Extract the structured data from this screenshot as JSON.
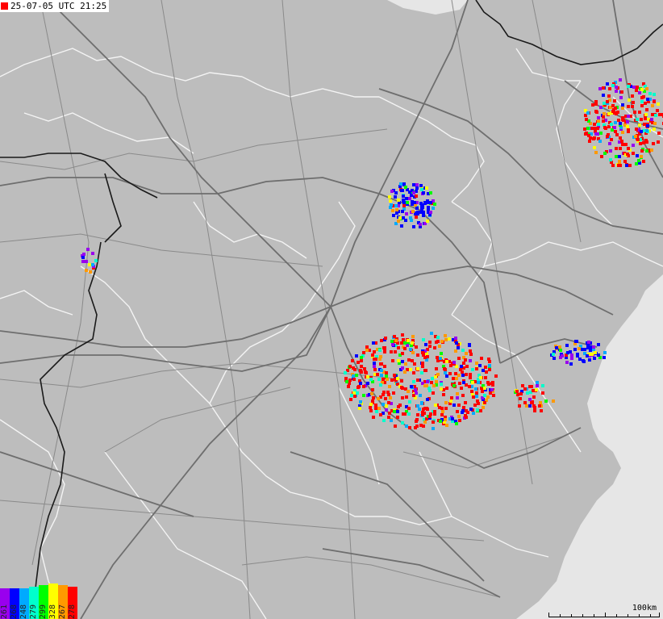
{
  "timestamp": {
    "text": "25-07-05 UTC 21:25",
    "marker_color": "#ff0000"
  },
  "legend": {
    "items": [
      {
        "label": "261",
        "color": "#9900ee"
      },
      {
        "label": "268",
        "color": "#0000ff"
      },
      {
        "label": "248",
        "color": "#00aaff"
      },
      {
        "label": "279",
        "color": "#00ffcc"
      },
      {
        "label": "299",
        "color": "#00ff00"
      },
      {
        "label": "328",
        "color": "#ffff00"
      },
      {
        "label": "267",
        "color": "#ff9900"
      },
      {
        "label": "278",
        "color": "#ff0000"
      }
    ]
  },
  "scale": {
    "label": "100km"
  },
  "colors": {
    "land": "#bdbdbd",
    "sea": "#e6e6e6",
    "roads_major": "#6e6e6e",
    "roads_minor": "#8a8a8a",
    "admin_borders": "#f4f4f4",
    "country_borders": "#1a1a1a"
  }
}
